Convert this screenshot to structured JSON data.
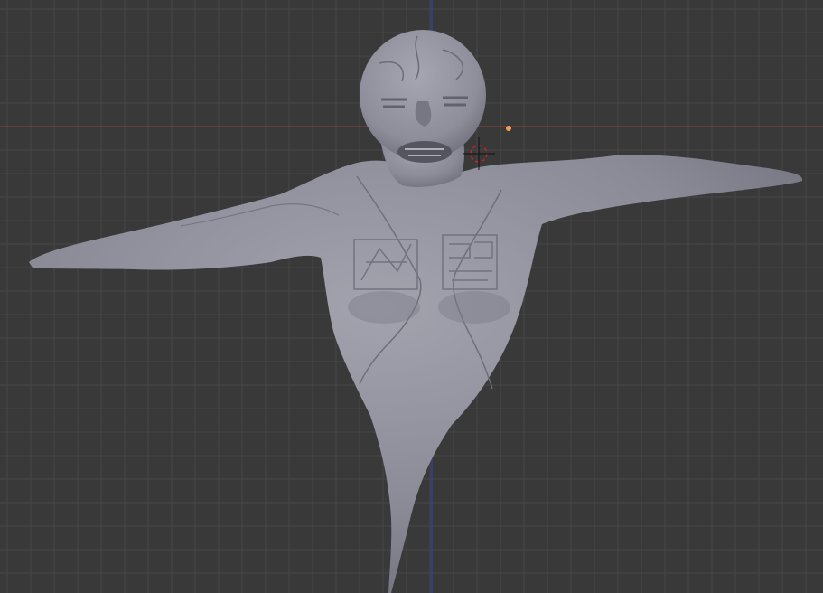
{
  "viewport": {
    "mode": "3d-viewport",
    "background_color": "#393939",
    "grid_line_color": "#464646",
    "x_axis_color": "#9a3d3d",
    "z_axis_color": "#3b3fb3",
    "object": {
      "type": "sculpted-mesh",
      "shape": "humanoid-ghost-figure",
      "base_color": "#8b8b98",
      "shade_color": "#6d6d7a",
      "highlight_color": "#a3a3ae"
    },
    "cursor": {
      "icon": "3d-cursor-icon",
      "color": "#cc2222"
    },
    "origin_point": {
      "icon": "object-origin-dot",
      "color": "#f0a050"
    }
  }
}
